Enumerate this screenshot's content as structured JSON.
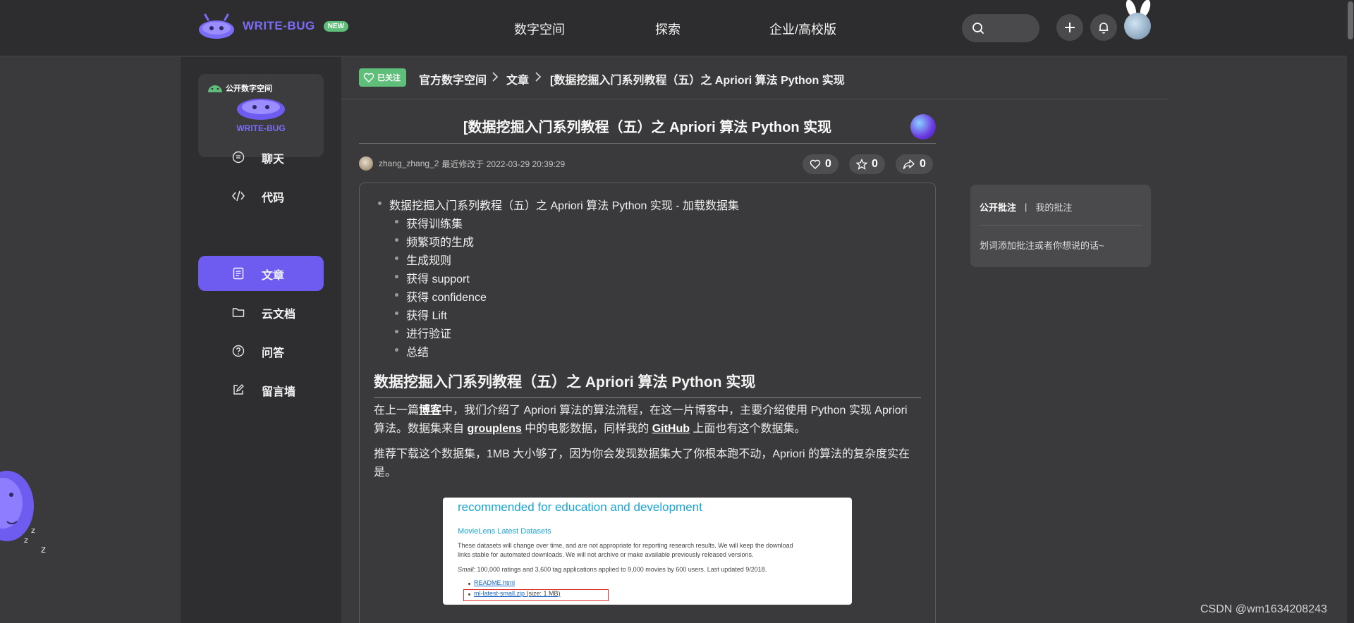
{
  "topbar": {
    "brand": "WRITE-BUG",
    "badge": "NEW",
    "nav": [
      "数字空间",
      "探索",
      "企业/高校版"
    ]
  },
  "sidebar": {
    "space_tag": "公开数字空间",
    "space_name": "WRITE-BUG",
    "items": [
      {
        "label": "聊天",
        "icon": "chat-icon"
      },
      {
        "label": "代码",
        "icon": "code-icon"
      },
      {
        "label": "文章",
        "icon": "article-icon",
        "active": true
      },
      {
        "label": "云文档",
        "icon": "folder-icon"
      },
      {
        "label": "问答",
        "icon": "question-icon"
      },
      {
        "label": "留言墙",
        "icon": "edit-icon"
      }
    ]
  },
  "breadcrumb": {
    "follow_label": "已关注",
    "items": [
      "官方数字空间",
      "文章",
      "[数据挖掘入门系列教程（五）之 Apriori 算法 Python 实现"
    ]
  },
  "article": {
    "title": "[数据挖掘入门系列教程（五）之 Apriori 算法 Python 实现",
    "author": "zhang_zhang_2",
    "modified_text": "最近修改于 2022-03-29 20:39:29",
    "likes": "0",
    "favorites": "0",
    "shares": "0",
    "toc": {
      "top": "数据挖掘入门系列教程（五）之 Apriori 算法 Python 实现 - 加载数据集",
      "children": [
        "获得训练集",
        "频繁项的生成",
        "生成规则",
        "获得 support",
        "获得 confidence",
        "获得 Lift",
        "进行验证",
        "总结"
      ]
    },
    "heading": "数据挖掘入门系列教程（五）之 Apriori 算法 Python 实现",
    "p1_a": "在上一篇",
    "p1_link1": "博客",
    "p1_b": "中，我们介绍了 Apriori 算法的算法流程，在这一片博客中，主要介绍使用 Python 实现 Apriori 算法。数据集来自 ",
    "p1_link2": "grouplens",
    "p1_c": " 中的电影数据，同样我的 ",
    "p1_link3": "GitHub",
    "p1_d": " 上面也有这个数据集。",
    "p2": "推荐下载这个数据集，1MB 大小够了，因为你会发现数据集大了你根本跑不动，Apriori 的算法的复杂度实在是。",
    "embed": {
      "heading": "recommended for education and development",
      "subheading": "MovieLens Latest Datasets",
      "para1_line1": "These datasets will change over time, and are not appropriate for reporting research results. We will keep the download",
      "para1_line2": "links stable for automated downloads. We will not archive or make available previously released versions.",
      "para2_label": "Small:",
      "para2_text": " 100,000 ratings and 3,600 tag applications applied to 9,000 movies by 600 users. Last updated 9/2018.",
      "link1": "README.html",
      "link2": "ml-latest-small.zip",
      "link2_suffix": " (size: 1 MB)"
    }
  },
  "annotations": {
    "tab_public": "公开批注",
    "separator": "|",
    "tab_mine": "我的批注",
    "hint": "划词添加批注或者你想说的话~"
  },
  "watermark": "CSDN @wm1634208243",
  "colors": {
    "accent": "#6e5cf0",
    "follow_green": "#5fbe7a",
    "page_bg": "#3a3a3c"
  }
}
